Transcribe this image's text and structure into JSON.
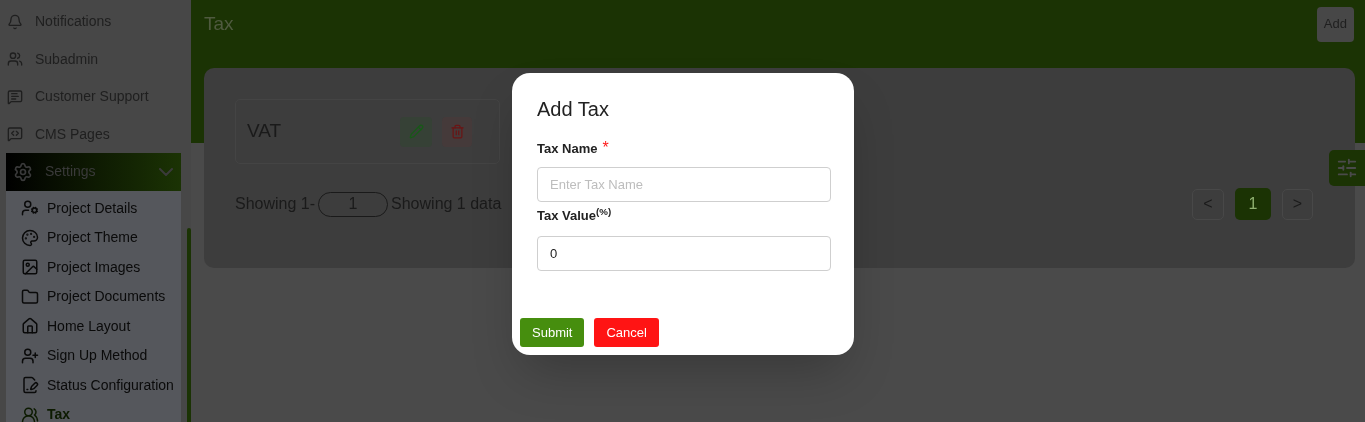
{
  "sidebar": {
    "items": [
      {
        "label": "Notifications",
        "selected": false
      },
      {
        "label": "Subadmin",
        "selected": false
      },
      {
        "label": "Customer Support",
        "selected": false
      },
      {
        "label": "CMS Pages",
        "selected": false
      },
      {
        "label": "Settings",
        "selected": true,
        "expanded": true,
        "children": [
          {
            "label": "Project Details",
            "selected": false
          },
          {
            "label": "Project Theme",
            "selected": false
          },
          {
            "label": "Project Images",
            "selected": false
          },
          {
            "label": "Project Documents",
            "selected": false
          },
          {
            "label": "Home Layout",
            "selected": false
          },
          {
            "label": "Sign Up Method",
            "selected": false
          },
          {
            "label": "Status Configuration",
            "selected": false
          },
          {
            "label": "Tax",
            "selected": true
          }
        ]
      }
    ]
  },
  "page": {
    "title": "Tax",
    "add_button": "Add"
  },
  "taxes": [
    {
      "name": "VAT"
    }
  ],
  "footer": {
    "showing_prefix": "Showing 1-",
    "per_page": "1",
    "summary": "Showing 1 data"
  },
  "pagination": {
    "prev": "<",
    "next": ">",
    "pages": [
      {
        "label": "1",
        "selected": true
      }
    ]
  },
  "modal": {
    "title": "Add Tax",
    "fields": [
      {
        "label": "Tax Name",
        "required_mark": "*",
        "placeholder": "Enter Tax Name"
      },
      {
        "label": "Tax Value$^{(%)}$",
        "value": "0"
      }
    ],
    "submit": "Submit",
    "cancel": "Cancel"
  }
}
